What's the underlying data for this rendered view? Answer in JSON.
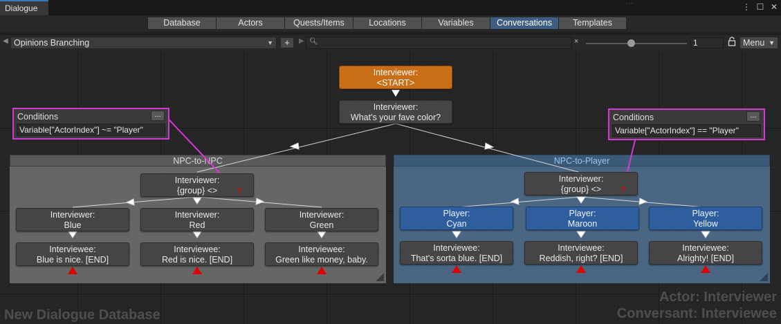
{
  "window": {
    "tab_title": "Dialogue",
    "icons": [
      "more-icon",
      "maximize-icon",
      "close-icon"
    ]
  },
  "tabs": [
    {
      "label": "Database",
      "active": false
    },
    {
      "label": "Actors",
      "active": false
    },
    {
      "label": "Quests/Items",
      "active": false
    },
    {
      "label": "Locations",
      "active": false
    },
    {
      "label": "Variables",
      "active": false
    },
    {
      "label": "Conversations",
      "active": true
    },
    {
      "label": "Templates",
      "active": false
    }
  ],
  "toolbar": {
    "conversation": "Opinions Branching",
    "add_label": "+",
    "search_value": "",
    "clear_label": "×",
    "zoom_value": "1",
    "zoom_level": 0.45,
    "menu_label": "Menu"
  },
  "canvas": {
    "start_node": {
      "line1": "Interviewer:",
      "line2": "<START>"
    },
    "question_node": {
      "line1": "Interviewer:",
      "line2": "What's your fave color?"
    },
    "groups": {
      "left": {
        "title": "NPC-to-NPC",
        "group_node": {
          "line1": "Interviewer:",
          "line2": "{group} <>"
        },
        "nodes": [
          {
            "line1": "Interviewer:",
            "line2": "Blue"
          },
          {
            "line1": "Interviewer:",
            "line2": "Red"
          },
          {
            "line1": "Interviewer:",
            "line2": "Green"
          }
        ],
        "end_nodes": [
          {
            "line1": "Interviewee:",
            "line2": "Blue is nice. [END]"
          },
          {
            "line1": "Interviewee:",
            "line2": "Red is nice. [END]"
          },
          {
            "line1": "Interviewee:",
            "line2": "Green like money, baby."
          }
        ]
      },
      "right": {
        "title": "NPC-to-Player",
        "group_node": {
          "line1": "Interviewer:",
          "line2": "{group} <>"
        },
        "nodes": [
          {
            "line1": "Player:",
            "line2": "Cyan"
          },
          {
            "line1": "Player:",
            "line2": "Maroon"
          },
          {
            "line1": "Player:",
            "line2": "Yellow"
          }
        ],
        "end_nodes": [
          {
            "line1": "Interviewee:",
            "line2": "That's sorta blue. [END]"
          },
          {
            "line1": "Interviewee:",
            "line2": "Reddish, right? [END]"
          },
          {
            "line1": "Interviewee:",
            "line2": "Alrighty! [END]"
          }
        ]
      }
    },
    "conditions_left": {
      "label": "Conditions",
      "button": "...",
      "value": "Variable[\"ActorIndex\"] ~= \"Player\""
    },
    "conditions_right": {
      "label": "Conditions",
      "button": "...",
      "value": "Variable[\"ActorIndex\"] == \"Player\""
    },
    "watermarks": {
      "database": "New Dialogue Database",
      "actor": "Actor: Interviewer",
      "conversant": "Conversant: Interviewee"
    },
    "colors": {
      "start_node": "#c96e17",
      "player_node": "#2e5e9e",
      "annotation": "#d638d4",
      "end_marker": "#e00000",
      "condition_marker": "#d01010"
    }
  }
}
